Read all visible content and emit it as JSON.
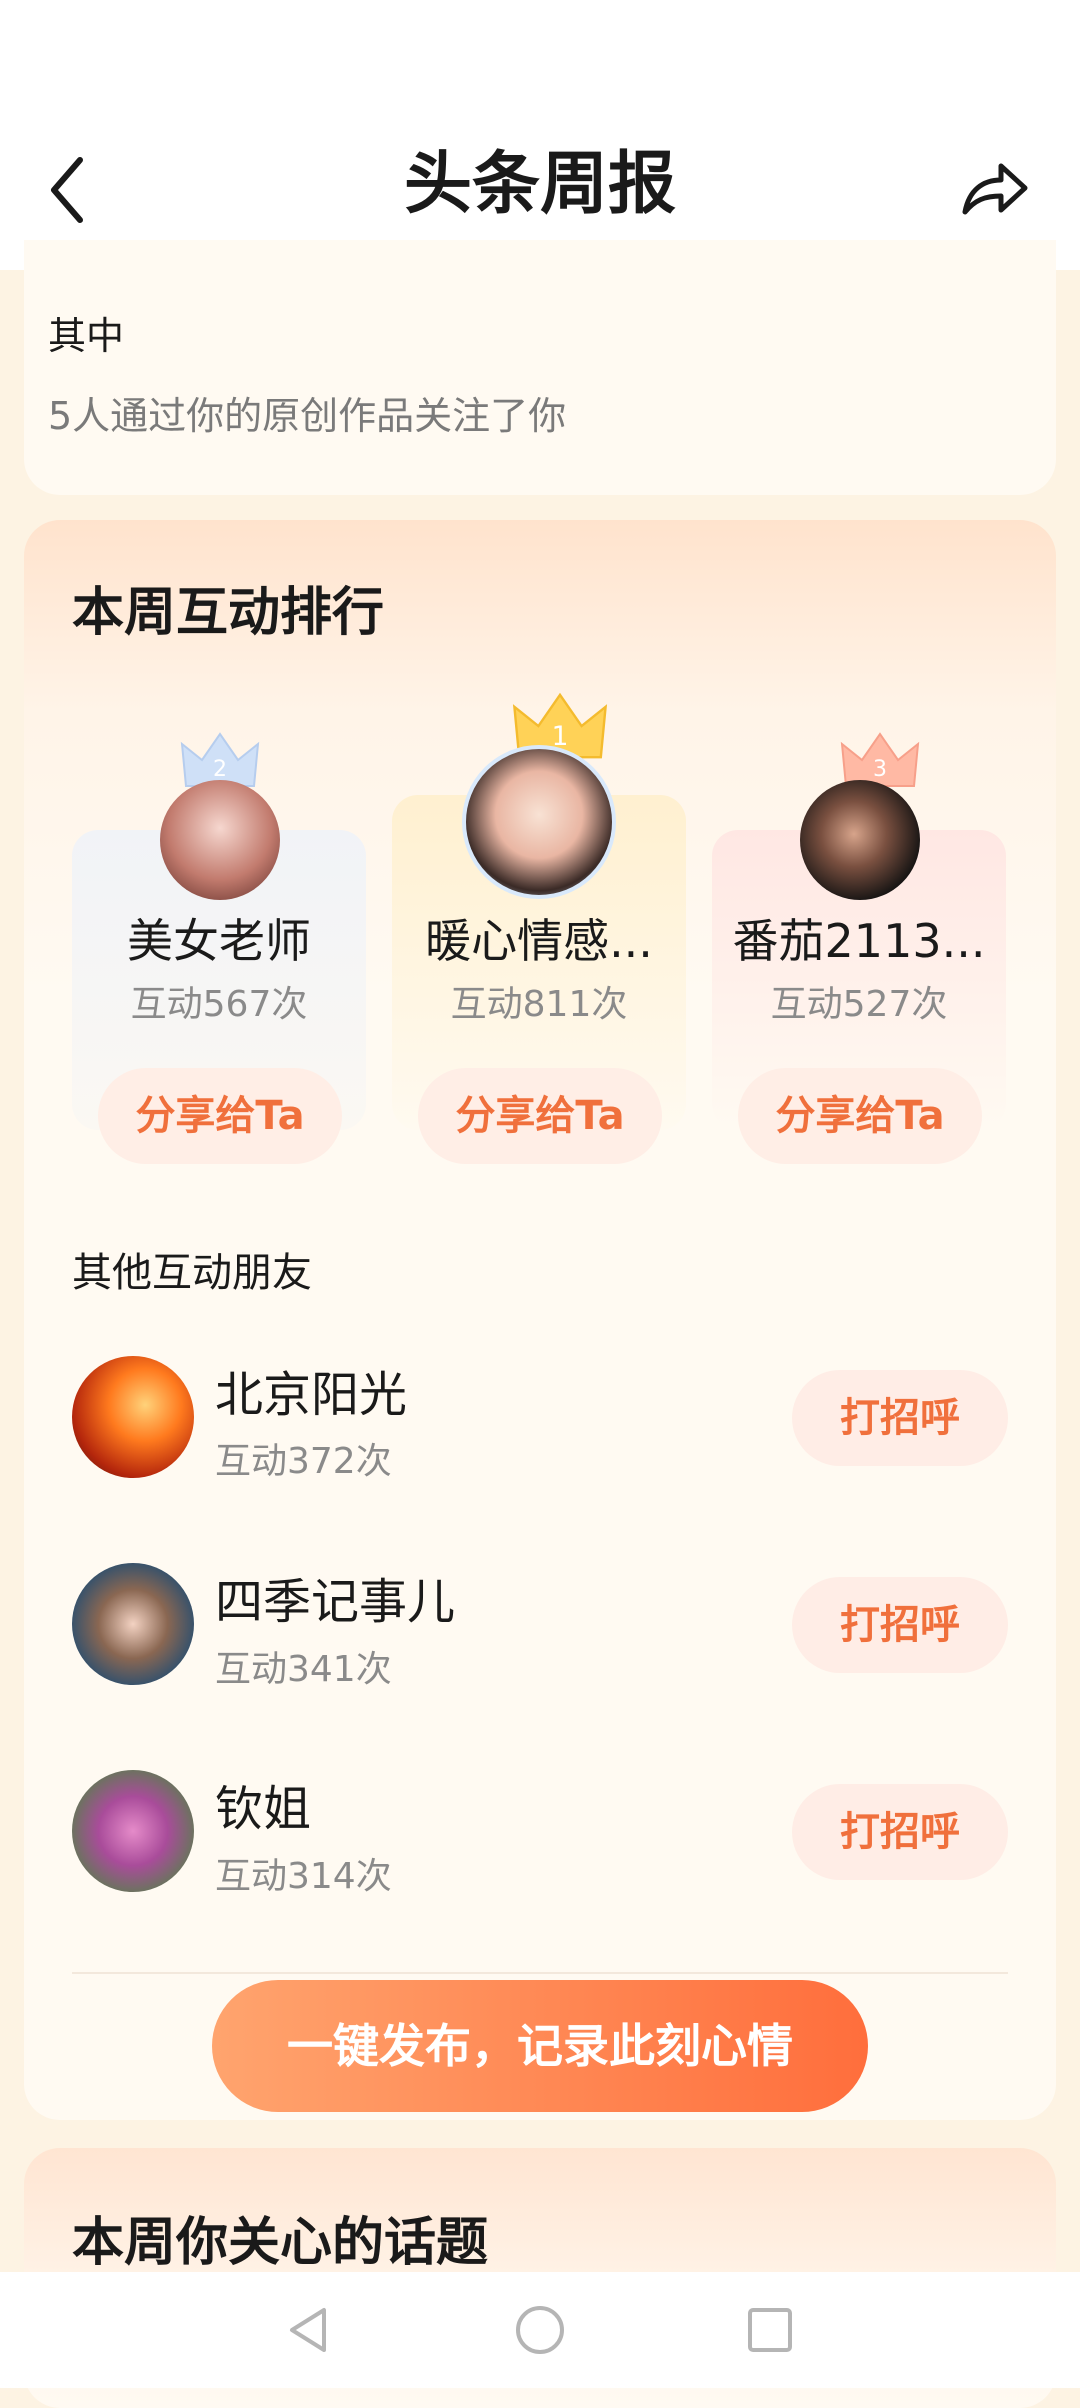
{
  "header": {
    "title": "头条周报"
  },
  "summary": {
    "label": "其中",
    "text": "5人通过你的原创作品关注了你"
  },
  "ranking": {
    "title": "本周互动排行",
    "top": [
      {
        "rank": "2",
        "name": "美女老师",
        "count": "互动567次",
        "share_label": "分享给Ta"
      },
      {
        "rank": "1",
        "name": "暖心情感...",
        "count": "互动811次",
        "share_label": "分享给Ta"
      },
      {
        "rank": "3",
        "name": "番茄2113...",
        "count": "互动527次",
        "share_label": "分享给Ta"
      }
    ],
    "others_title": "其他互动朋友",
    "others": [
      {
        "name": "北京阳光",
        "count": "互动372次",
        "action": "打招呼"
      },
      {
        "name": "四季记事儿",
        "count": "互动341次",
        "action": "打招呼"
      },
      {
        "name": "钦姐",
        "count": "互动314次",
        "action": "打招呼"
      }
    ],
    "publish_label": "一键发布，记录此刻心情"
  },
  "topics": {
    "title": "本周你关心的话题"
  },
  "colors": {
    "accent": "#f0703c",
    "card": "#fffaf2",
    "page_bg": "#fdf3e3"
  },
  "icons": {
    "back": "chevron-left-icon",
    "share": "share-arrow-icon",
    "nav_back": "triangle-back-icon",
    "nav_home": "circle-home-icon",
    "nav_recent": "square-recent-icon"
  }
}
